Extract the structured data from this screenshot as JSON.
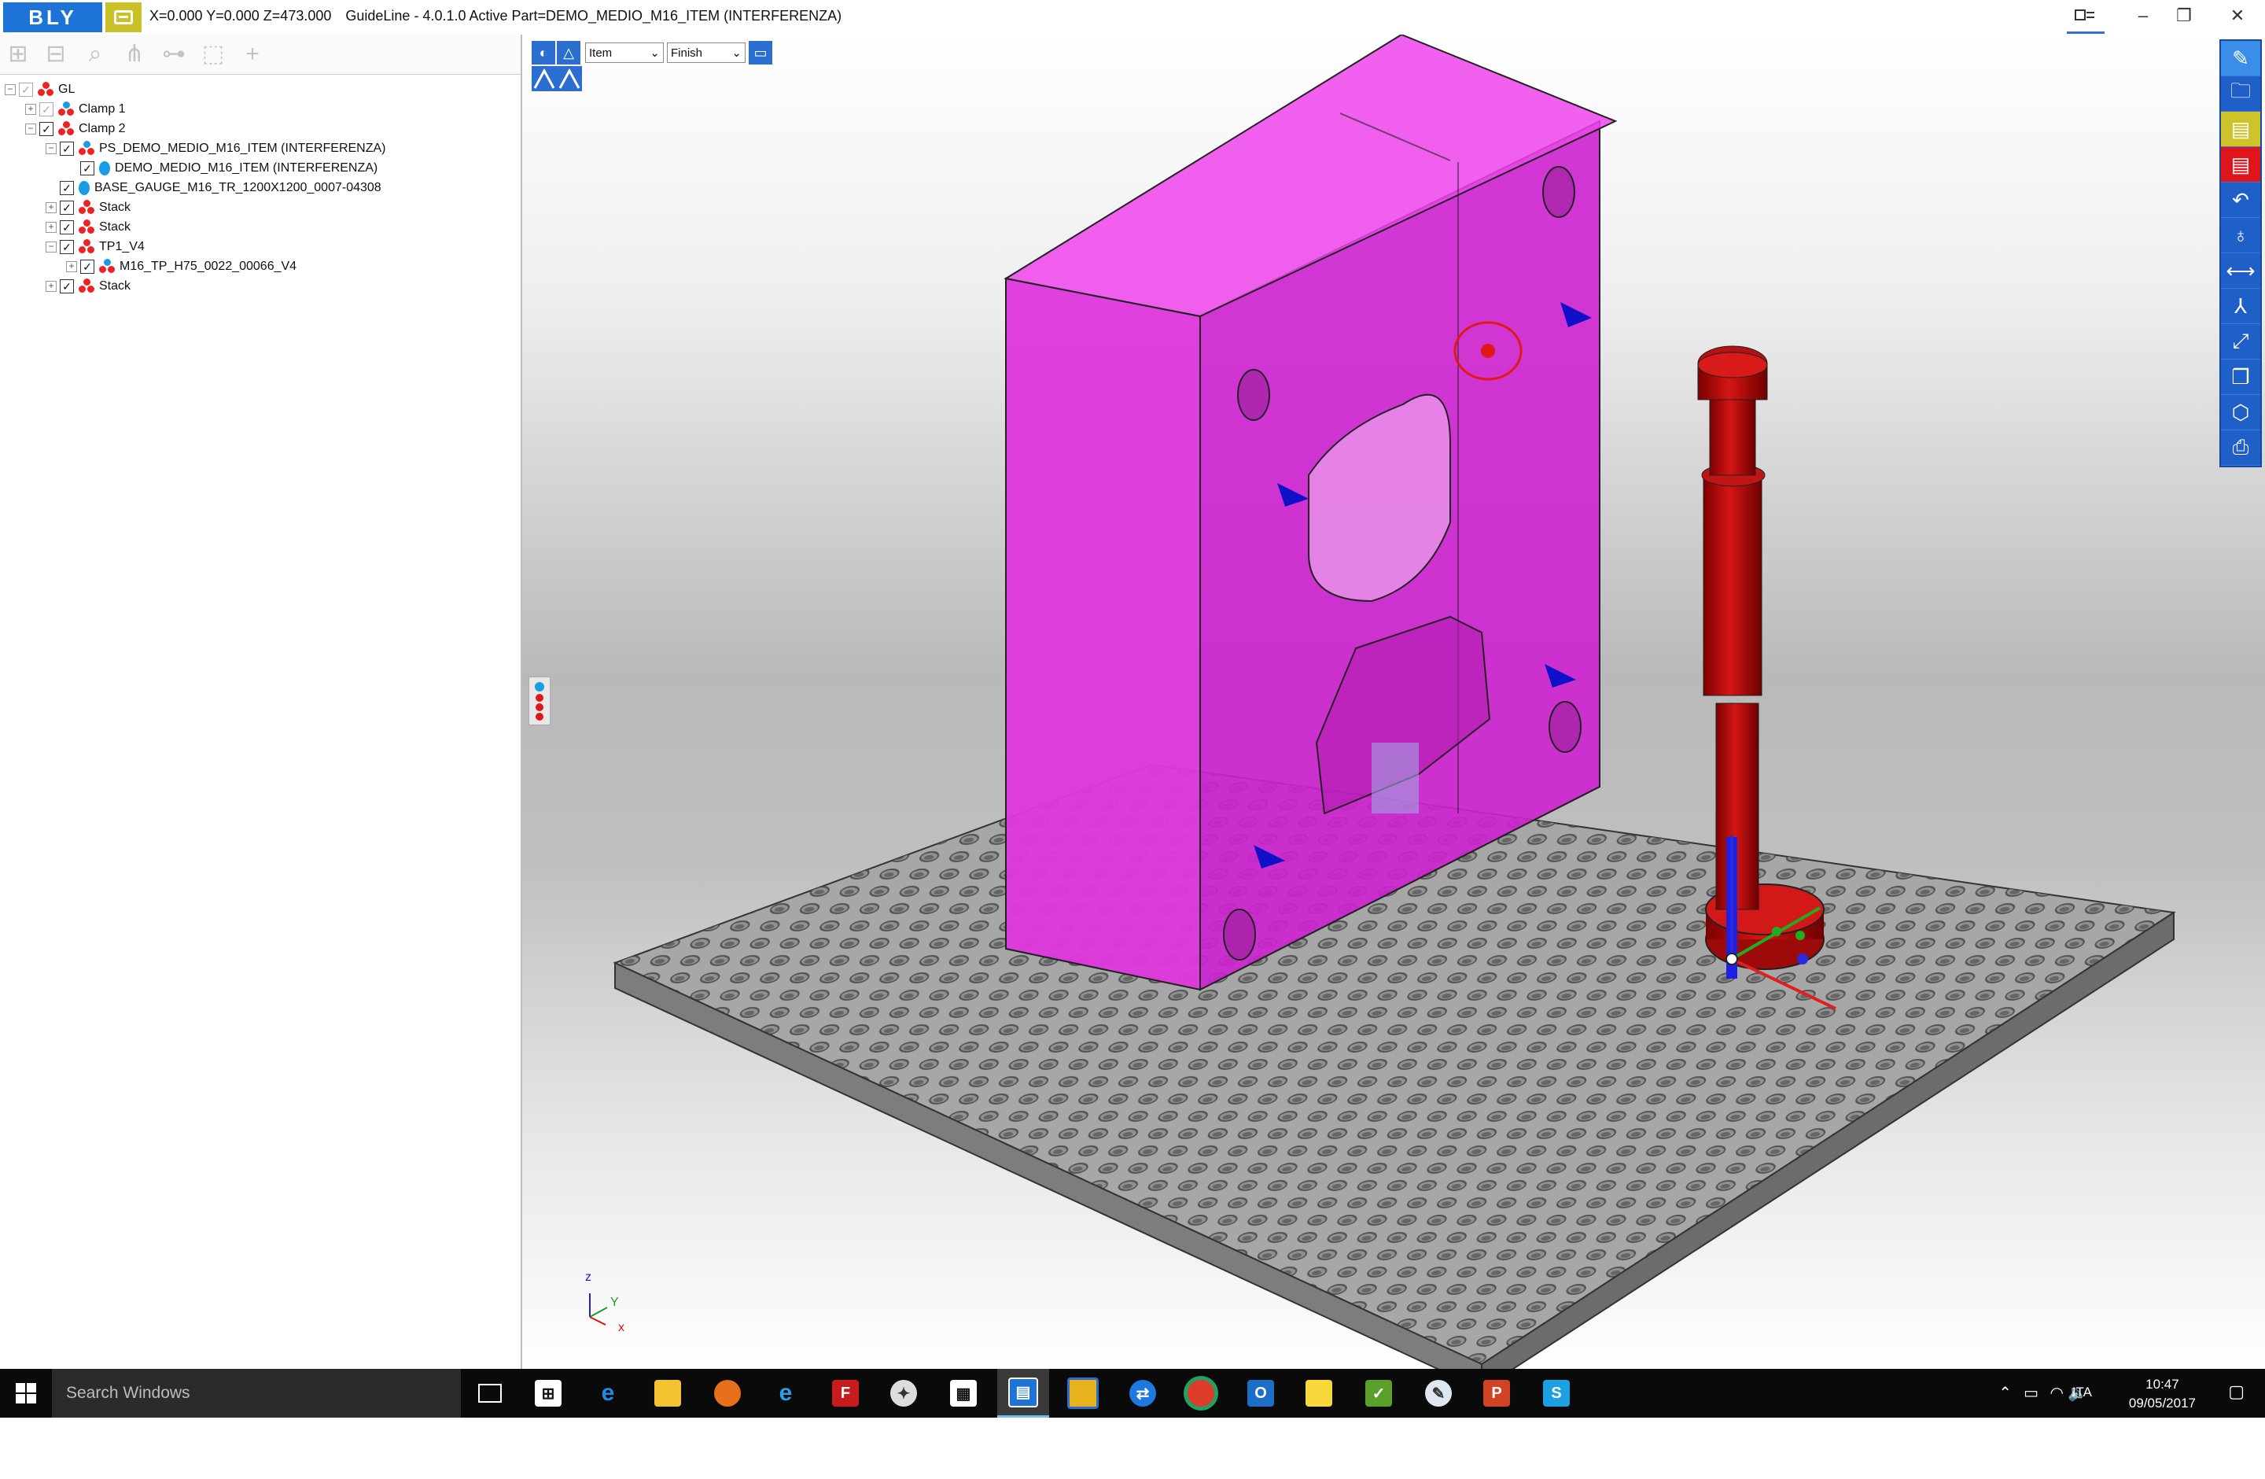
{
  "titlebar": {
    "logo_text": "BLY",
    "coords": "X=0.000 Y=0.000 Z=473.000",
    "title": "GuideLine - 4.0.1.0 Active Part=DEMO_MEDIO_M16_ITEM (INTERFERENZA)",
    "minimize": "–",
    "restore": "❐",
    "close": "✕",
    "pin_icon": "pin-icon"
  },
  "tree": {
    "rows": [
      {
        "label": "GL"
      },
      {
        "label": "Clamp 1"
      },
      {
        "label": "Clamp 2"
      },
      {
        "label": "PS_DEMO_MEDIO_M16_ITEM (INTERFERENZA)"
      },
      {
        "label": "DEMO_MEDIO_M16_ITEM (INTERFERENZA)"
      },
      {
        "label": "BASE_GAUGE_M16_TR_1200X1200_0007-04308"
      },
      {
        "label": "Stack"
      },
      {
        "label": "Stack"
      },
      {
        "label": "TP1_V4"
      },
      {
        "label": "M16_TP_H75_0022_00066_V4"
      },
      {
        "label": "Stack"
      }
    ]
  },
  "viewport": {
    "mode_select": "Item",
    "finish_select": "Finish",
    "axis": {
      "z": "z",
      "y": "Y",
      "x": "x"
    }
  },
  "taskbar": {
    "search_placeholder": "Search Windows",
    "language": "ITA",
    "time": "10:47",
    "date": "09/05/2017"
  },
  "colors": {
    "accent_blue": "#1e73d8",
    "magenta_part": "#e81fe0",
    "red_tool": "#c41010",
    "logo_yellow": "#c9c227"
  }
}
